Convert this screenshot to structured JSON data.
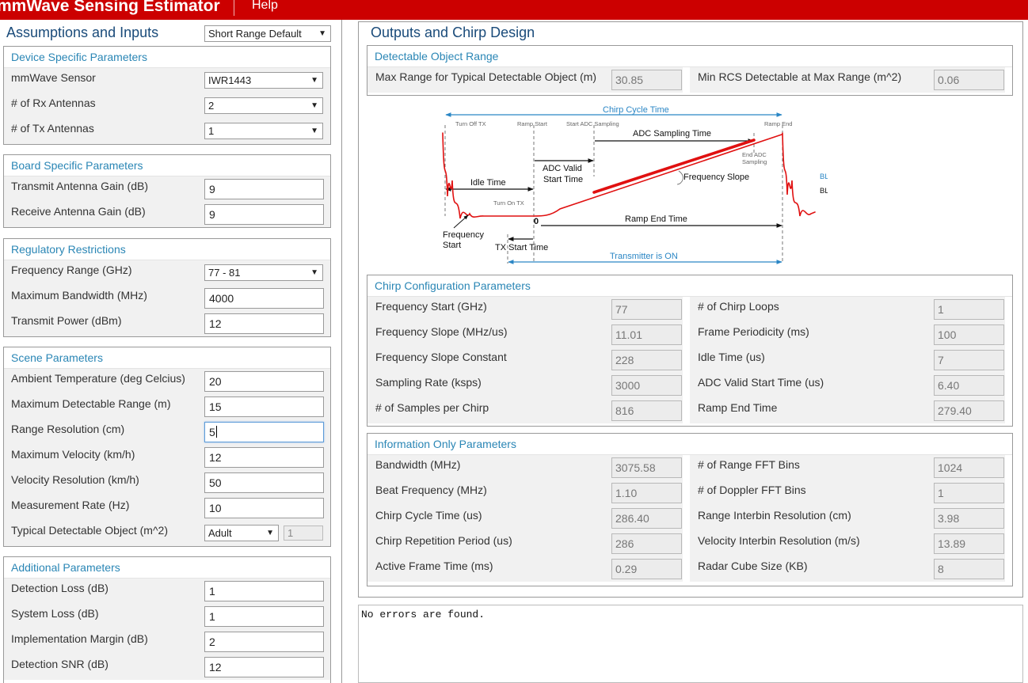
{
  "app": {
    "title": "mmWave Sensing Estimator",
    "help": "Help"
  },
  "left": {
    "heading": "Assumptions and Inputs",
    "preset": "Short Range Default",
    "device": {
      "title": "Device Specific Parameters",
      "rows": [
        {
          "label": "mmWave Sensor",
          "value": "IWR1443"
        },
        {
          "label": "# of Rx Antennas",
          "value": "2"
        },
        {
          "label": "# of Tx Antennas",
          "value": "1"
        }
      ]
    },
    "board": {
      "title": "Board Specific Parameters",
      "rows": [
        {
          "label": "Transmit Antenna Gain (dB)",
          "value": "9"
        },
        {
          "label": "Receive Antenna Gain (dB)",
          "value": "9"
        }
      ]
    },
    "regulatory": {
      "title": "Regulatory Restrictions",
      "rows": [
        {
          "label": "Frequency Range (GHz)",
          "value": "77 - 81"
        },
        {
          "label": "Maximum Bandwidth (MHz)",
          "value": "4000"
        },
        {
          "label": "Transmit Power (dBm)",
          "value": "12"
        }
      ]
    },
    "scene": {
      "title": "Scene Parameters",
      "rows": [
        {
          "label": "Ambient Temperature (deg Celcius)",
          "value": "20"
        },
        {
          "label": "Maximum Detectable Range (m)",
          "value": "15"
        },
        {
          "label": "Range Resolution (cm)",
          "value": "5"
        },
        {
          "label": "Maximum Velocity (km/h)",
          "value": "12"
        },
        {
          "label": "Velocity Resolution (km/h)",
          "value": "50"
        },
        {
          "label": "Measurement Rate (Hz)",
          "value": "10"
        },
        {
          "label": "Typical Detectable Object (m^2)",
          "value": "Adult",
          "extra": "1"
        }
      ]
    },
    "additional": {
      "title": "Additional Parameters",
      "rows": [
        {
          "label": "Detection Loss (dB)",
          "value": "1"
        },
        {
          "label": "System Loss (dB)",
          "value": "1"
        },
        {
          "label": "Implementation Margin (dB)",
          "value": "2"
        },
        {
          "label": "Detection SNR (dB)",
          "value": "12"
        }
      ]
    }
  },
  "right": {
    "heading": "Outputs and Chirp Design",
    "range": {
      "title": "Detectable Object Range",
      "left": {
        "label": "Max Range for Typical Detectable Object (m)",
        "value": "30.85"
      },
      "right": {
        "label": "Min RCS Detectable at Max Range (m^2)",
        "value": "0.06"
      }
    },
    "diagram": {
      "chirp_cycle_time": "Chirp Cycle Time",
      "turn_off_tx": "Turn Off TX",
      "ramp_start": "Ramp Start",
      "start_adc_sampling": "Start ADC Sampling",
      "ramp_end": "Ramp End",
      "adc_sampling_time": "ADC Sampling Time",
      "adc_valid_start_time_1": "ADC Valid",
      "adc_valid_start_time_2": "Start Time",
      "end_adc_sampling_1": "End ADC",
      "end_adc_sampling_2": "Sampling",
      "idle_time": "Idle Time",
      "frequency_slope": "Frequency Slope",
      "turn_on_tx": "Turn On TX",
      "zero": "0",
      "ramp_end_time": "Ramp End Time",
      "frequency_start_1": "Frequency",
      "frequency_start_2": "Start",
      "tx_start_time": "TX Start Time",
      "transmitter_on": "Transmitter is ON",
      "legend_blue": "BLUE = Information only.",
      "legend_black": "BLACK = Front-end configuration.",
      "colors": {
        "blue": "#2a86c5",
        "red": "#e01010"
      }
    },
    "chirp": {
      "title": "Chirp Configuration Parameters",
      "rows": [
        {
          "l_label": "Frequency Start (GHz)",
          "l_value": "77",
          "r_label": "# of Chirp Loops",
          "r_value": "1"
        },
        {
          "l_label": "Frequency Slope (MHz/us)",
          "l_value": "11.01",
          "r_label": "Frame Periodicity (ms)",
          "r_value": "100"
        },
        {
          "l_label": "Frequency Slope Constant",
          "l_value": "228",
          "r_label": "Idle Time (us)",
          "r_value": "7"
        },
        {
          "l_label": "Sampling Rate (ksps)",
          "l_value": "3000",
          "r_label": "ADC Valid Start Time (us)",
          "r_value": "6.40"
        },
        {
          "l_label": "# of Samples per Chirp",
          "l_value": "816",
          "r_label": "Ramp End Time",
          "r_value": "279.40"
        }
      ]
    },
    "info": {
      "title": "Information Only Parameters",
      "rows": [
        {
          "l_label": "Bandwidth (MHz)",
          "l_value": "3075.58",
          "r_label": "# of Range FFT Bins",
          "r_value": "1024"
        },
        {
          "l_label": "Beat Frequency (MHz)",
          "l_value": "1.10",
          "r_label": "# of Doppler FFT Bins",
          "r_value": "1"
        },
        {
          "l_label": "Chirp Cycle Time (us)",
          "l_value": "286.40",
          "r_label": "Range Interbin Resolution (cm)",
          "r_value": "3.98"
        },
        {
          "l_label": "Chirp Repetition Period (us)",
          "l_value": "286",
          "r_label": "Velocity Interbin Resolution (m/s)",
          "r_value": "13.89"
        },
        {
          "l_label": "Active Frame Time (ms)",
          "l_value": "0.29",
          "r_label": "Radar Cube Size (KB)",
          "r_value": "8"
        }
      ]
    }
  },
  "errors": {
    "message": "No errors are found."
  }
}
